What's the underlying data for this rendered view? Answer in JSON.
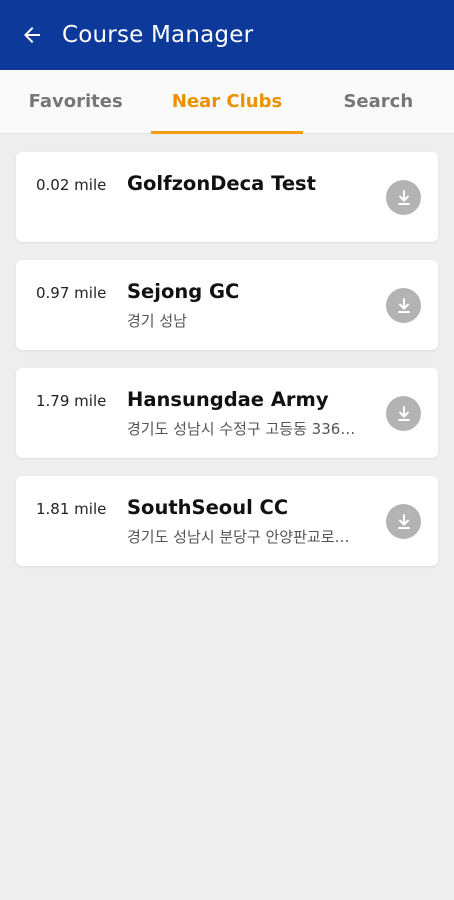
{
  "appbar": {
    "title": "Course Manager",
    "back_icon": "arrow-left-icon"
  },
  "tabs": [
    {
      "label": "Favorites",
      "active": false
    },
    {
      "label": "Near Clubs",
      "active": true
    },
    {
      "label": "Search",
      "active": false
    }
  ],
  "clubs": [
    {
      "distance": "0.02 mile",
      "name": "GolfzonDeca Test",
      "address": ""
    },
    {
      "distance": "0.97 mile",
      "name": "Sejong GC",
      "address": "경기 성남"
    },
    {
      "distance": "1.79 mile",
      "name": "Hansungdae Army",
      "address": "경기도 성남시 수정구 고등동 336…"
    },
    {
      "distance": "1.81 mile",
      "name": "SouthSeoul CC",
      "address": "경기도 성남시 분당구 안양판교로…"
    }
  ],
  "colors": {
    "appbar": "#0d3a9a",
    "accent": "#f39c12",
    "download_button": "#b3b3b3"
  },
  "download_icon": "download-icon"
}
